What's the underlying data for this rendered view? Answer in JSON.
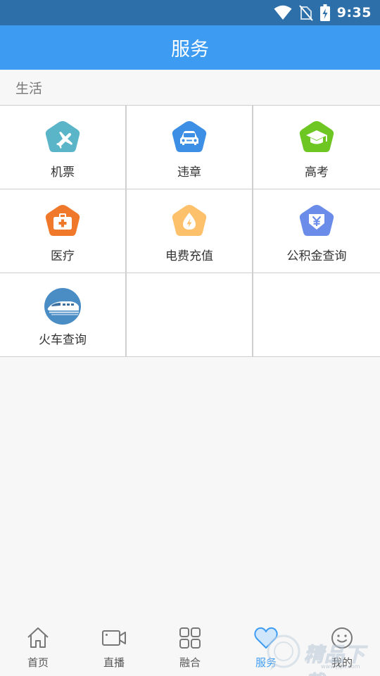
{
  "status_bar": {
    "time": "9:35",
    "icons": [
      "wifi-icon",
      "no-sim-icon",
      "battery-charging-icon"
    ]
  },
  "app_bar": {
    "title": "服务"
  },
  "section": {
    "title": "生活"
  },
  "services": [
    {
      "label": "机票",
      "icon": "plane-icon",
      "color": "#5bb5c8"
    },
    {
      "label": "违章",
      "icon": "car-icon",
      "color": "#3d8fe6"
    },
    {
      "label": "高考",
      "icon": "graduation-cap-icon",
      "color": "#6ec623"
    },
    {
      "label": "医疗",
      "icon": "medical-kit-icon",
      "color": "#f0782a"
    },
    {
      "label": "电费充值",
      "icon": "electricity-drop-icon",
      "color": "#fdc16b"
    },
    {
      "label": "公积金查询",
      "icon": "yuan-fund-icon",
      "color": "#6b8ce8"
    },
    {
      "label": "火车查询",
      "icon": "train-icon",
      "color": "#4a8cc4"
    }
  ],
  "bottom_nav": [
    {
      "label": "首页",
      "icon": "home-icon"
    },
    {
      "label": "直播",
      "icon": "video-camera-icon"
    },
    {
      "label": "融合",
      "icon": "grid-icon"
    },
    {
      "label": "服务",
      "icon": "heart-icon",
      "active": true
    },
    {
      "label": "我的",
      "icon": "smiley-face-icon"
    }
  ],
  "watermark": {
    "text": "精品下载",
    "sub": "www.jsjw.com"
  },
  "colors": {
    "status_bar": "#2d6fa8",
    "app_bar": "#3d9cf2",
    "active_tab": "#3d9cf2",
    "background": "#f7f7f7",
    "grid_line": "#cfcfcf"
  }
}
